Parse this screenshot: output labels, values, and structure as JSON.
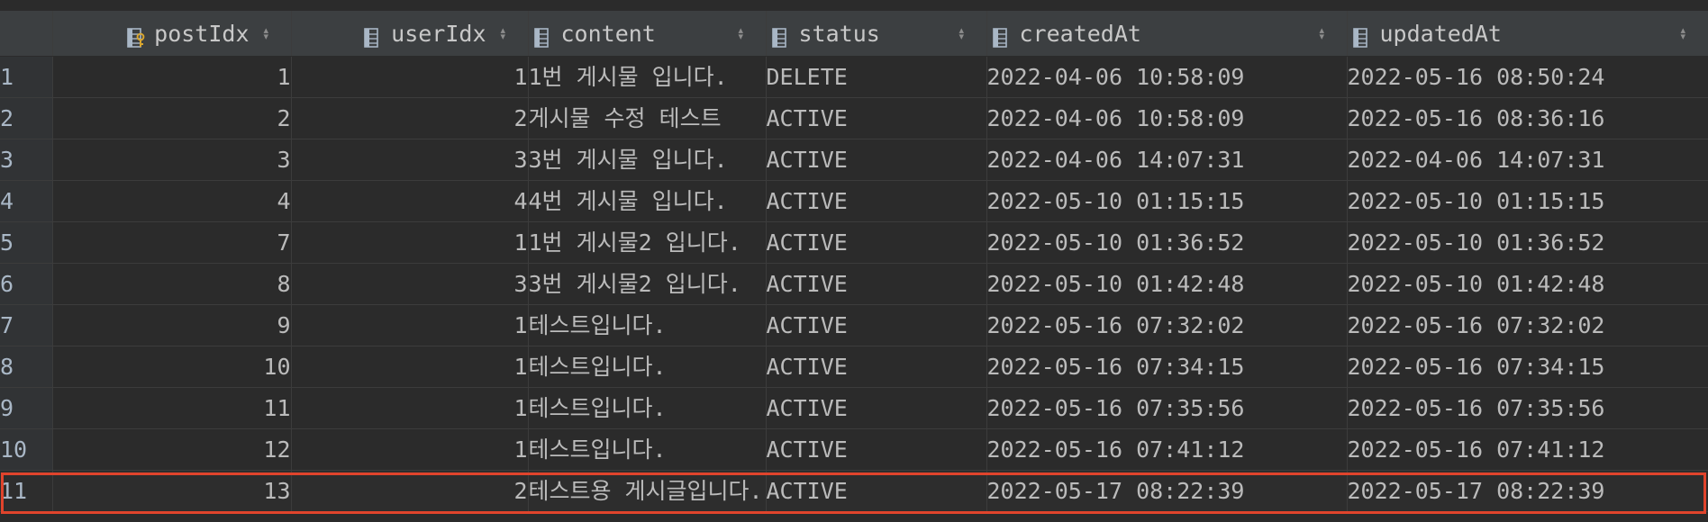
{
  "table": {
    "columns": [
      {
        "key": "rownum",
        "label": "",
        "icon": "",
        "align": "left"
      },
      {
        "key": "postIdx",
        "label": "postIdx",
        "icon": "primary-key-column-icon",
        "align": "right"
      },
      {
        "key": "userIdx",
        "label": "userIdx",
        "icon": "column-icon",
        "align": "right"
      },
      {
        "key": "content",
        "label": "content",
        "icon": "column-icon",
        "align": "left"
      },
      {
        "key": "status",
        "label": "status",
        "icon": "column-icon",
        "align": "left"
      },
      {
        "key": "createdAt",
        "label": "createdAt",
        "icon": "column-icon",
        "align": "left"
      },
      {
        "key": "updatedAt",
        "label": "updatedAt",
        "icon": "column-icon",
        "align": "left"
      }
    ],
    "sort_icon": "sort-arrows-icon",
    "rows": [
      {
        "rownum": "1",
        "postIdx": "1",
        "userIdx": "1",
        "content": "1번 게시물 입니다.",
        "status": "DELETE",
        "createdAt": "2022-04-06 10:58:09",
        "updatedAt": "2022-05-16 08:50:24"
      },
      {
        "rownum": "2",
        "postIdx": "2",
        "userIdx": "2",
        "content": "게시물 수정 테스트",
        "status": "ACTIVE",
        "createdAt": "2022-04-06 10:58:09",
        "updatedAt": "2022-05-16 08:36:16"
      },
      {
        "rownum": "3",
        "postIdx": "3",
        "userIdx": "3",
        "content": "3번 게시물 입니다.",
        "status": "ACTIVE",
        "createdAt": "2022-04-06 14:07:31",
        "updatedAt": "2022-04-06 14:07:31"
      },
      {
        "rownum": "4",
        "postIdx": "4",
        "userIdx": "4",
        "content": "4번 게시물 입니다.",
        "status": "ACTIVE",
        "createdAt": "2022-05-10 01:15:15",
        "updatedAt": "2022-05-10 01:15:15"
      },
      {
        "rownum": "5",
        "postIdx": "7",
        "userIdx": "1",
        "content": "1번 게시물2 입니다.",
        "status": "ACTIVE",
        "createdAt": "2022-05-10 01:36:52",
        "updatedAt": "2022-05-10 01:36:52"
      },
      {
        "rownum": "6",
        "postIdx": "8",
        "userIdx": "3",
        "content": "3번 게시물2 입니다.",
        "status": "ACTIVE",
        "createdAt": "2022-05-10 01:42:48",
        "updatedAt": "2022-05-10 01:42:48"
      },
      {
        "rownum": "7",
        "postIdx": "9",
        "userIdx": "1",
        "content": "테스트입니다.",
        "status": "ACTIVE",
        "createdAt": "2022-05-16 07:32:02",
        "updatedAt": "2022-05-16 07:32:02"
      },
      {
        "rownum": "8",
        "postIdx": "10",
        "userIdx": "1",
        "content": "테스트입니다.",
        "status": "ACTIVE",
        "createdAt": "2022-05-16 07:34:15",
        "updatedAt": "2022-05-16 07:34:15"
      },
      {
        "rownum": "9",
        "postIdx": "11",
        "userIdx": "1",
        "content": "테스트입니다.",
        "status": "ACTIVE",
        "createdAt": "2022-05-16 07:35:56",
        "updatedAt": "2022-05-16 07:35:56"
      },
      {
        "rownum": "10",
        "postIdx": "12",
        "userIdx": "1",
        "content": "테스트입니다.",
        "status": "ACTIVE",
        "createdAt": "2022-05-16 07:41:12",
        "updatedAt": "2022-05-16 07:41:12"
      },
      {
        "rownum": "11",
        "postIdx": "13",
        "userIdx": "2",
        "content": "테스트용 게시글입니다.",
        "status": "ACTIVE",
        "createdAt": "2022-05-17 08:22:39",
        "updatedAt": "2022-05-17 08:22:39"
      }
    ],
    "highlighted_row": "11"
  },
  "colors": {
    "background": "#2b2b2b",
    "header_bg": "#3c3f41",
    "gutter_bg": "#313335",
    "text": "#bbbbbb",
    "highlight_border": "#e0442c",
    "key_icon": "#d8a630"
  }
}
